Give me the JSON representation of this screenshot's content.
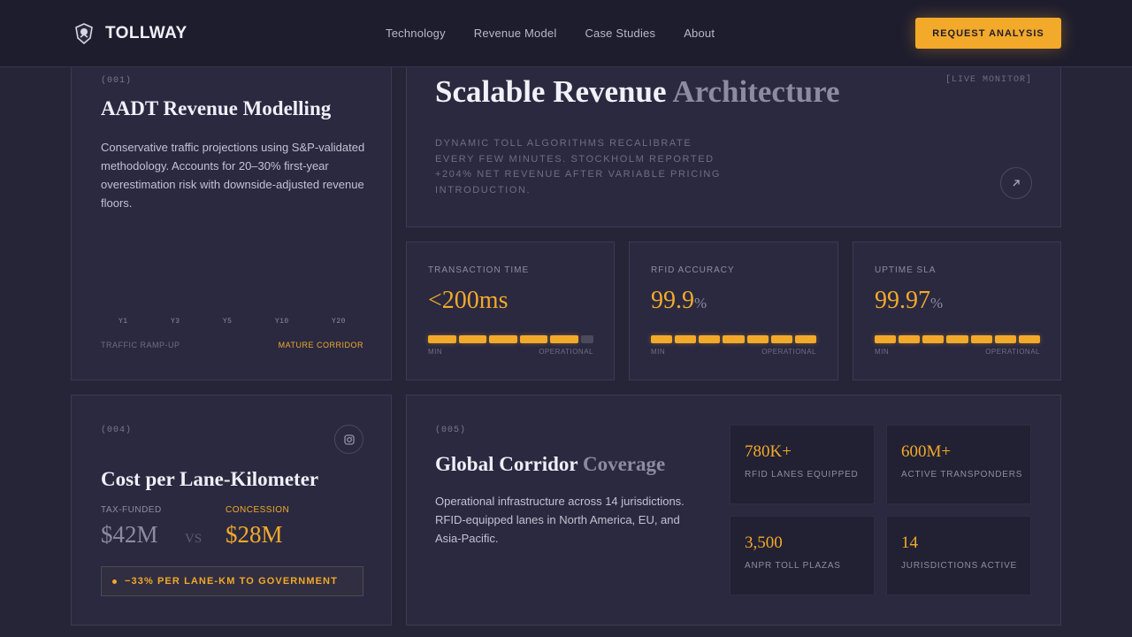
{
  "nav": {
    "brand": "TOLLWAY",
    "links": [
      "Technology",
      "Revenue Model",
      "Case Studies",
      "About"
    ],
    "cta": "REQUEST ANALYSIS"
  },
  "aadt_card": {
    "number": "(001)",
    "title": "AADT Revenue Modelling",
    "description": "Conservative traffic projections using S&P-validated methodology. Accounts for 20–30% first-year overestimation risk with downside-adjusted revenue floors.",
    "years": [
      "Y1",
      "Y3",
      "Y5",
      "Y10",
      "Y20"
    ],
    "footer_left": "TRAFFIC RAMP-UP",
    "footer_right": "MATURE CORRIDOR"
  },
  "architecture_card": {
    "title_main": "Scalable Revenue",
    "title_accent": "Architecture",
    "tag": "[LIVE MONITOR]",
    "description": "Dynamic toll algorithms recalibrate every few minutes. Stockholm reported +204% net revenue after variable pricing introduction."
  },
  "metrics": [
    {
      "label": "TRANSACTION TIME",
      "value": "<200ms",
      "unit": "",
      "scale_min": "MIN",
      "scale_max": "OPERATIONAL",
      "filled_segments": 5,
      "total_segments": 6
    },
    {
      "label": "RFID ACCURACY",
      "value": "99.9",
      "unit": "%",
      "scale_min": "MIN",
      "scale_max": "OPERATIONAL",
      "filled_segments": 7,
      "total_segments": 7
    },
    {
      "label": "UPTIME SLA",
      "value": "99.97",
      "unit": "%",
      "scale_min": "MIN",
      "scale_max": "OPERATIONAL",
      "filled_segments": 7,
      "total_segments": 7
    }
  ],
  "cost_card": {
    "number": "(004)",
    "title": "Cost per Lane-Kilometer",
    "left_label": "TAX-FUNDED",
    "left_value": "$42M",
    "vs": "VS",
    "right_label": "CONCESSION",
    "right_value": "$28M",
    "callout": "−33% PER LANE-KM TO GOVERNMENT"
  },
  "coverage_card": {
    "number": "(005)",
    "title_main": "Global Corridor",
    "title_accent": "Coverage",
    "description": "Operational infrastructure across 14 jurisdictions. RFID-equipped lanes in North America, EU, and Asia-Pacific.",
    "stats": [
      {
        "value": "780K+",
        "label": "RFID LANES EQUIPPED"
      },
      {
        "value": "600M+",
        "label": "ACTIVE TRANSPONDERS"
      },
      {
        "value": "3,500",
        "label": "ANPR TOLL PLAZAS"
      },
      {
        "value": "14",
        "label": "JURISDICTIONS ACTIVE"
      }
    ]
  },
  "colors": {
    "background": "#262538",
    "card": "#2a2940",
    "accent": "#f3a92a",
    "muted": "#8d8ba2"
  }
}
